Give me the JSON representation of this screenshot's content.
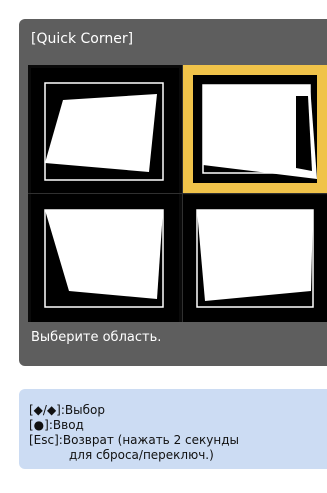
{
  "panel": {
    "title": "[Quick Corner]",
    "status": "Выберите область."
  },
  "areas": [
    {
      "name": "top-left",
      "selected": false
    },
    {
      "name": "top-right",
      "selected": true
    },
    {
      "name": "bottom-left",
      "selected": false
    },
    {
      "name": "bottom-right",
      "selected": false
    }
  ],
  "help": {
    "select_key": "[◆/◆]",
    "select_label": ":Выбор",
    "enter_key": "[●]",
    "enter_label": ":Ввод",
    "esc_key": "[Esc]",
    "esc_label_line1": ":Возврат (нажать 2 секунды",
    "esc_label_line2": "для сброса/переключ.)"
  },
  "colors": {
    "panel_bg": "#5e5e5e",
    "selection": "#f0c34a",
    "help_bg": "#ccdcf3"
  }
}
